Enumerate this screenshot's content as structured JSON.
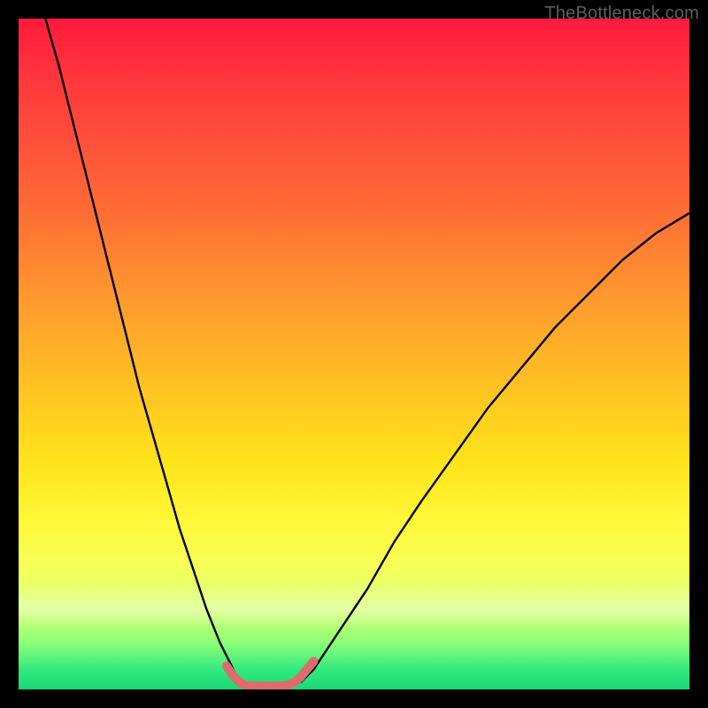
{
  "watermark": "TheBottleneck.com",
  "chart_data": {
    "type": "line",
    "title": "",
    "xlabel": "",
    "ylabel": "",
    "xlim": [
      0,
      100
    ],
    "ylim": [
      0,
      100
    ],
    "series": [
      {
        "name": "left-curve",
        "x": [
          4,
          6,
          8,
          10,
          12,
          14,
          16,
          18,
          20,
          22,
          24,
          26,
          28,
          30,
          32,
          33
        ],
        "y": [
          100,
          93,
          85,
          77,
          69,
          61,
          53,
          45,
          38,
          31,
          24,
          18,
          12,
          7,
          3,
          1
        ]
      },
      {
        "name": "right-curve",
        "x": [
          42,
          44,
          46,
          48,
          52,
          56,
          60,
          65,
          70,
          75,
          80,
          85,
          90,
          95,
          100
        ],
        "y": [
          1,
          3,
          6,
          9,
          15,
          22,
          28,
          35,
          42,
          48,
          54,
          59,
          64,
          68,
          71
        ]
      },
      {
        "name": "valley-highlight",
        "x": [
          31,
          32,
          33,
          34,
          36,
          38,
          40,
          41,
          42,
          43,
          44
        ],
        "y": [
          3.5,
          2,
          1,
          0.6,
          0.5,
          0.5,
          0.6,
          1,
          1.8,
          3,
          4.2
        ]
      }
    ],
    "colors": {
      "curve": "#000000",
      "highlight": "#dd6c6c"
    }
  }
}
